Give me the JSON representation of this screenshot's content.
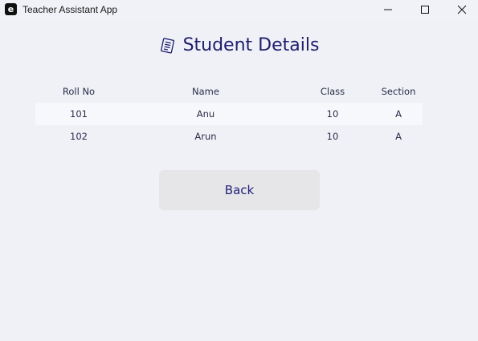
{
  "window": {
    "icon_letter": "e",
    "title": "Teacher Assistant App"
  },
  "page": {
    "heading_icon": "notepad-icon",
    "heading": "Student Details"
  },
  "table": {
    "headers": [
      "Roll No",
      "Name",
      "Class",
      "Section"
    ],
    "rows": [
      [
        "101",
        "Anu",
        "10",
        "A"
      ],
      [
        "102",
        "Arun",
        "10",
        "A"
      ]
    ]
  },
  "actions": {
    "back_label": "Back"
  },
  "colors": {
    "accent": "#1f1d6e",
    "background": "#eff1f6",
    "button": "#e6e6e9"
  }
}
